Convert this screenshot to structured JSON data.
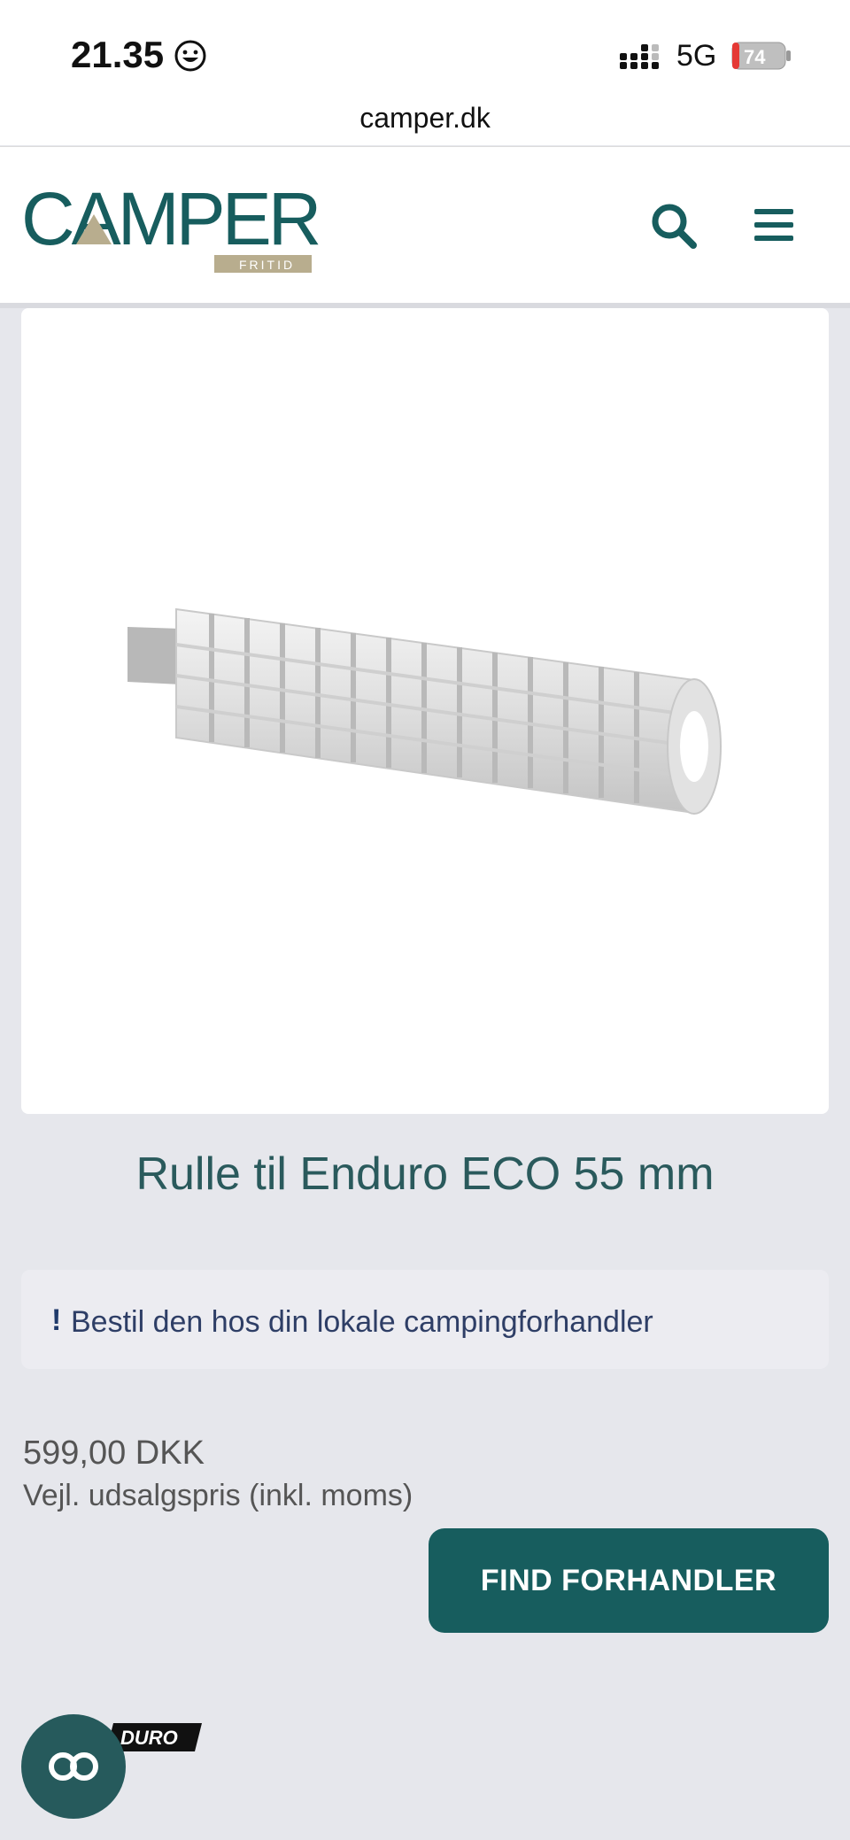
{
  "status_bar": {
    "time": "21.35",
    "network": "5G",
    "battery": "74"
  },
  "browser": {
    "url": "camper.dk"
  },
  "header": {
    "logo_text": "CAMPER",
    "logo_sub": "FRITID",
    "search_icon": "search-icon",
    "menu_icon": "hamburger-menu-icon"
  },
  "product": {
    "title": "Rulle til Enduro ECO 55 mm",
    "notice_mark": "!",
    "notice": "Bestil den hos din lokale campingforhandler",
    "price": "599,00 DKK",
    "price_note": "Vejl. udsalgspris (inkl. moms)",
    "find_dealer_label": "FIND FORHANDLER",
    "brand_logo_text": "DURO"
  },
  "colors": {
    "brand": "#175d5e",
    "logo_accent": "#b8ad8e",
    "background": "#e6e7ec"
  }
}
